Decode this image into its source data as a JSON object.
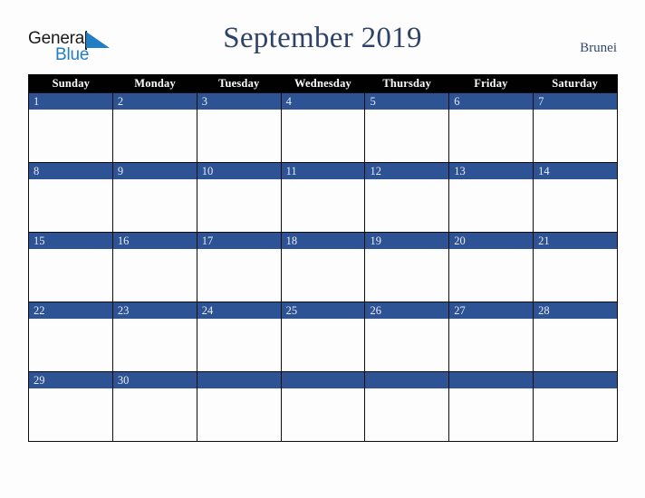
{
  "brand": {
    "name_part1": "General",
    "name_part2": "Blue",
    "triangle_icon": "blue-triangle-icon",
    "accent_color": "#1f7ec4",
    "text_color": "#1a1a1a"
  },
  "header": {
    "title": "September 2019",
    "country": "Brunei",
    "title_color": "#2f4369"
  },
  "calendar": {
    "month": "September",
    "year": "2019",
    "day_header_bg": "#010101",
    "day_header_fg": "#ffffff",
    "day_number_bg": "#2d5394",
    "day_number_fg": "#e8ecf5",
    "cell_bg": "#fdfdfd",
    "border_color": "#0d0d0d",
    "weekday_headers": [
      "Sunday",
      "Monday",
      "Tuesday",
      "Wednesday",
      "Thursday",
      "Friday",
      "Saturday"
    ],
    "weeks": [
      [
        {
          "day": "1",
          "events": ""
        },
        {
          "day": "2",
          "events": ""
        },
        {
          "day": "3",
          "events": ""
        },
        {
          "day": "4",
          "events": ""
        },
        {
          "day": "5",
          "events": ""
        },
        {
          "day": "6",
          "events": ""
        },
        {
          "day": "7",
          "events": ""
        }
      ],
      [
        {
          "day": "8",
          "events": ""
        },
        {
          "day": "9",
          "events": ""
        },
        {
          "day": "10",
          "events": ""
        },
        {
          "day": "11",
          "events": ""
        },
        {
          "day": "12",
          "events": ""
        },
        {
          "day": "13",
          "events": ""
        },
        {
          "day": "14",
          "events": ""
        }
      ],
      [
        {
          "day": "15",
          "events": ""
        },
        {
          "day": "16",
          "events": ""
        },
        {
          "day": "17",
          "events": ""
        },
        {
          "day": "18",
          "events": ""
        },
        {
          "day": "19",
          "events": ""
        },
        {
          "day": "20",
          "events": ""
        },
        {
          "day": "21",
          "events": ""
        }
      ],
      [
        {
          "day": "22",
          "events": ""
        },
        {
          "day": "23",
          "events": ""
        },
        {
          "day": "24",
          "events": ""
        },
        {
          "day": "25",
          "events": ""
        },
        {
          "day": "26",
          "events": ""
        },
        {
          "day": "27",
          "events": ""
        },
        {
          "day": "28",
          "events": ""
        }
      ],
      [
        {
          "day": "29",
          "events": ""
        },
        {
          "day": "30",
          "events": ""
        },
        {
          "day": "",
          "events": ""
        },
        {
          "day": "",
          "events": ""
        },
        {
          "day": "",
          "events": ""
        },
        {
          "day": "",
          "events": ""
        },
        {
          "day": "",
          "events": ""
        }
      ]
    ]
  }
}
